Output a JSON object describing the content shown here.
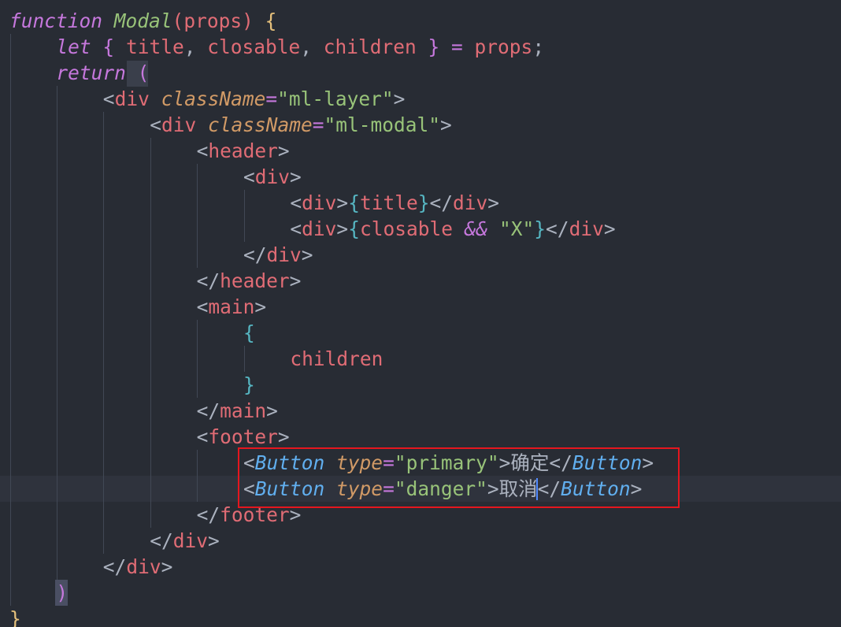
{
  "editor": {
    "theme": {
      "background": "#282c34",
      "active_line": "#2f333d",
      "guide": "#414855",
      "highlight_box": "#e5161e",
      "caret": "#528bff"
    },
    "active_line_index": 18,
    "lines": [
      {
        "indent": 0,
        "tokens": [
          {
            "t": "function",
            "c": "#c678dd",
            "i": true
          },
          {
            "t": " ",
            "c": "#abb2bf"
          },
          {
            "t": "Modal",
            "c": "#98c379",
            "i": true
          },
          {
            "t": "(",
            "c": "#e06c75"
          },
          {
            "t": "props",
            "c": "#e06c75"
          },
          {
            "t": ")",
            "c": "#e06c75"
          },
          {
            "t": " {",
            "c": "#e5c07b"
          }
        ]
      },
      {
        "indent": 1,
        "tokens": [
          {
            "t": "let",
            "c": "#c678dd",
            "i": true
          },
          {
            "t": " ",
            "c": "#abb2bf"
          },
          {
            "t": "{",
            "c": "#c678dd"
          },
          {
            "t": " title",
            "c": "#e06c75"
          },
          {
            "t": ",",
            "c": "#abb2bf"
          },
          {
            "t": " closable",
            "c": "#e06c75"
          },
          {
            "t": ",",
            "c": "#abb2bf"
          },
          {
            "t": " children",
            "c": "#e06c75"
          },
          {
            "t": " }",
            "c": "#c678dd"
          },
          {
            "t": " = ",
            "c": "#c678dd"
          },
          {
            "t": "props",
            "c": "#e06c75"
          },
          {
            "t": ";",
            "c": "#abb2bf"
          }
        ]
      },
      {
        "indent": 1,
        "tokens": [
          {
            "t": "return",
            "c": "#c678dd",
            "i": true
          },
          {
            "t": " ",
            "c": "#abb2bf"
          },
          {
            "t": "(",
            "c": "#c678dd"
          }
        ]
      },
      {
        "indent": 2,
        "tokens": [
          {
            "t": "<",
            "c": "#abb2bf"
          },
          {
            "t": "div",
            "c": "#e06c75"
          },
          {
            "t": " ",
            "c": "#abb2bf"
          },
          {
            "t": "className",
            "c": "#d19a66",
            "i": true
          },
          {
            "t": "=",
            "c": "#c678dd"
          },
          {
            "t": "\"ml-layer\"",
            "c": "#98c379"
          },
          {
            "t": ">",
            "c": "#abb2bf"
          }
        ]
      },
      {
        "indent": 3,
        "tokens": [
          {
            "t": "<",
            "c": "#abb2bf"
          },
          {
            "t": "div",
            "c": "#e06c75"
          },
          {
            "t": " ",
            "c": "#abb2bf"
          },
          {
            "t": "className",
            "c": "#d19a66",
            "i": true
          },
          {
            "t": "=",
            "c": "#c678dd"
          },
          {
            "t": "\"ml-modal\"",
            "c": "#98c379"
          },
          {
            "t": ">",
            "c": "#abb2bf"
          }
        ]
      },
      {
        "indent": 4,
        "tokens": [
          {
            "t": "<",
            "c": "#abb2bf"
          },
          {
            "t": "header",
            "c": "#e06c75"
          },
          {
            "t": ">",
            "c": "#abb2bf"
          }
        ]
      },
      {
        "indent": 5,
        "tokens": [
          {
            "t": "<",
            "c": "#abb2bf"
          },
          {
            "t": "div",
            "c": "#e06c75"
          },
          {
            "t": ">",
            "c": "#abb2bf"
          }
        ]
      },
      {
        "indent": 6,
        "tokens": [
          {
            "t": "<",
            "c": "#abb2bf"
          },
          {
            "t": "div",
            "c": "#e06c75"
          },
          {
            "t": ">",
            "c": "#abb2bf"
          },
          {
            "t": "{",
            "c": "#56b6c2"
          },
          {
            "t": "title",
            "c": "#e06c75"
          },
          {
            "t": "}",
            "c": "#56b6c2"
          },
          {
            "t": "</",
            "c": "#abb2bf"
          },
          {
            "t": "div",
            "c": "#e06c75"
          },
          {
            "t": ">",
            "c": "#abb2bf"
          }
        ]
      },
      {
        "indent": 6,
        "tokens": [
          {
            "t": "<",
            "c": "#abb2bf"
          },
          {
            "t": "div",
            "c": "#e06c75"
          },
          {
            "t": ">",
            "c": "#abb2bf"
          },
          {
            "t": "{",
            "c": "#56b6c2"
          },
          {
            "t": "closable",
            "c": "#e06c75"
          },
          {
            "t": " ",
            "c": "#abb2bf"
          },
          {
            "t": "&&",
            "c": "#c678dd",
            "i": true
          },
          {
            "t": " ",
            "c": "#abb2bf"
          },
          {
            "t": "\"X\"",
            "c": "#98c379"
          },
          {
            "t": "}",
            "c": "#56b6c2"
          },
          {
            "t": "</",
            "c": "#abb2bf"
          },
          {
            "t": "div",
            "c": "#e06c75"
          },
          {
            "t": ">",
            "c": "#abb2bf"
          }
        ]
      },
      {
        "indent": 5,
        "tokens": [
          {
            "t": "</",
            "c": "#abb2bf"
          },
          {
            "t": "div",
            "c": "#e06c75"
          },
          {
            "t": ">",
            "c": "#abb2bf"
          }
        ]
      },
      {
        "indent": 4,
        "tokens": [
          {
            "t": "</",
            "c": "#abb2bf"
          },
          {
            "t": "header",
            "c": "#e06c75"
          },
          {
            "t": ">",
            "c": "#abb2bf"
          }
        ]
      },
      {
        "indent": 4,
        "tokens": [
          {
            "t": "<",
            "c": "#abb2bf"
          },
          {
            "t": "main",
            "c": "#e06c75"
          },
          {
            "t": ">",
            "c": "#abb2bf"
          }
        ]
      },
      {
        "indent": 5,
        "tokens": [
          {
            "t": "{",
            "c": "#56b6c2"
          }
        ]
      },
      {
        "indent": 6,
        "tokens": [
          {
            "t": "children",
            "c": "#e06c75"
          }
        ]
      },
      {
        "indent": 5,
        "tokens": [
          {
            "t": "}",
            "c": "#56b6c2"
          }
        ]
      },
      {
        "indent": 4,
        "tokens": [
          {
            "t": "</",
            "c": "#abb2bf"
          },
          {
            "t": "main",
            "c": "#e06c75"
          },
          {
            "t": ">",
            "c": "#abb2bf"
          }
        ]
      },
      {
        "indent": 4,
        "tokens": [
          {
            "t": "<",
            "c": "#abb2bf"
          },
          {
            "t": "footer",
            "c": "#e06c75"
          },
          {
            "t": ">",
            "c": "#abb2bf"
          }
        ]
      },
      {
        "indent": 5,
        "tokens": [
          {
            "t": "<",
            "c": "#abb2bf"
          },
          {
            "t": "Button",
            "c": "#61afef",
            "i": true
          },
          {
            "t": " ",
            "c": "#abb2bf"
          },
          {
            "t": "type",
            "c": "#d19a66",
            "i": true
          },
          {
            "t": "=",
            "c": "#c678dd"
          },
          {
            "t": "\"primary\"",
            "c": "#98c379"
          },
          {
            "t": ">",
            "c": "#abb2bf"
          },
          {
            "t": "确定",
            "c": "#abb2bf"
          },
          {
            "t": "</",
            "c": "#abb2bf"
          },
          {
            "t": "Button",
            "c": "#61afef",
            "i": true
          },
          {
            "t": ">",
            "c": "#abb2bf"
          }
        ]
      },
      {
        "indent": 5,
        "tokens": [
          {
            "t": "<",
            "c": "#abb2bf"
          },
          {
            "t": "Button",
            "c": "#61afef",
            "i": true
          },
          {
            "t": " ",
            "c": "#abb2bf"
          },
          {
            "t": "type",
            "c": "#d19a66",
            "i": true
          },
          {
            "t": "=",
            "c": "#c678dd"
          },
          {
            "t": "\"danger\"",
            "c": "#98c379"
          },
          {
            "t": ">",
            "c": "#abb2bf"
          },
          {
            "t": "取消",
            "c": "#abb2bf"
          },
          {
            "t": "</",
            "c": "#abb2bf"
          },
          {
            "t": "Button",
            "c": "#61afef",
            "i": true
          },
          {
            "t": ">",
            "c": "#abb2bf"
          }
        ]
      },
      {
        "indent": 4,
        "tokens": [
          {
            "t": "</",
            "c": "#abb2bf"
          },
          {
            "t": "footer",
            "c": "#e06c75"
          },
          {
            "t": ">",
            "c": "#abb2bf"
          }
        ]
      },
      {
        "indent": 3,
        "tokens": [
          {
            "t": "</",
            "c": "#abb2bf"
          },
          {
            "t": "div",
            "c": "#e06c75"
          },
          {
            "t": ">",
            "c": "#abb2bf"
          }
        ]
      },
      {
        "indent": 2,
        "tokens": [
          {
            "t": "</",
            "c": "#abb2bf"
          },
          {
            "t": "div",
            "c": "#e06c75"
          },
          {
            "t": ">",
            "c": "#abb2bf"
          }
        ]
      },
      {
        "indent": 1,
        "tokens": [
          {
            "t": ")",
            "c": "#c678dd"
          }
        ]
      },
      {
        "indent": 0,
        "tokens": [
          {
            "t": "}",
            "c": "#e5c07b"
          }
        ]
      }
    ]
  }
}
